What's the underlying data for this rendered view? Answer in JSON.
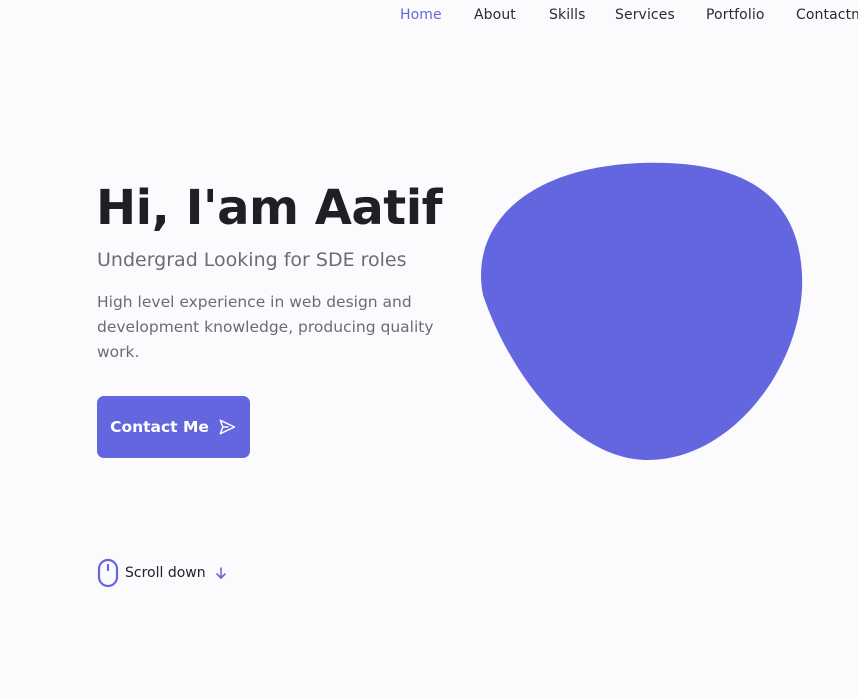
{
  "nav": {
    "items": [
      {
        "label": "Home",
        "active": true
      },
      {
        "label": "About",
        "active": false
      },
      {
        "label": "Skills",
        "active": false
      },
      {
        "label": "Services",
        "active": false
      },
      {
        "label": "Portfolio",
        "active": false
      },
      {
        "label": "Contactm",
        "active": false
      }
    ]
  },
  "hero": {
    "title": "Hi, I'am Aatif",
    "subtitle": "Undergrad Looking for SDE roles",
    "description": "High level experience in web design and development knowledge, producing quality work.",
    "button_label": "Contact Me",
    "button_icon": "send-icon",
    "scroll_label": "Scroll down",
    "scroll_icon": "mouse-icon",
    "scroll_arrow_icon": "arrow-down-icon",
    "blob_color": "#6466e0"
  },
  "colors": {
    "accent": "#6466e0",
    "background": "#fbfbfe",
    "title": "#1f1f26",
    "muted": "#6b6b7a"
  }
}
